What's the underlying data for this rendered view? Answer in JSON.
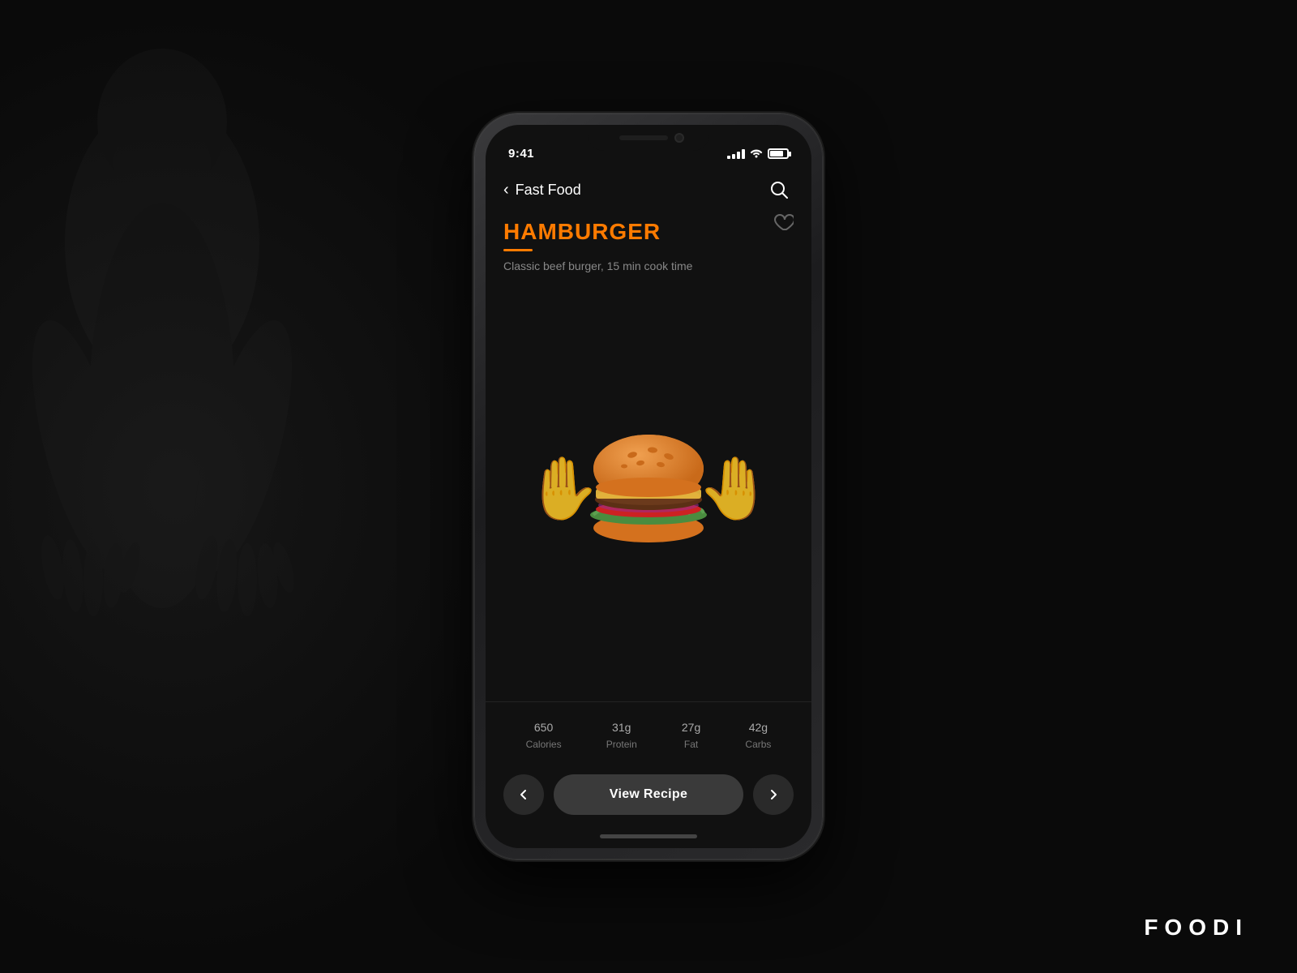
{
  "background": {
    "color": "#0a0a0a"
  },
  "brand": {
    "name": "FOODI"
  },
  "phone": {
    "status_bar": {
      "time": "9:41",
      "signal_bars": [
        3,
        5,
        7,
        9,
        11
      ],
      "battery_pct": 80
    },
    "nav": {
      "back_label": "‹",
      "title": "Fast Food",
      "search_label": "search"
    },
    "food": {
      "title": "HAMBURGER",
      "description": "Classic beef burger, 15 min cook time"
    },
    "nutrition": [
      {
        "value": "650",
        "unit": "",
        "label": "Calories"
      },
      {
        "value": "31",
        "unit": "g",
        "label": "Protein"
      },
      {
        "value": "27",
        "unit": "g",
        "label": "Fat"
      },
      {
        "value": "42",
        "unit": "g",
        "label": "Carbs"
      }
    ],
    "buttons": {
      "view_recipe": "View Recipe",
      "prev_label": "‹",
      "next_label": "›"
    }
  }
}
